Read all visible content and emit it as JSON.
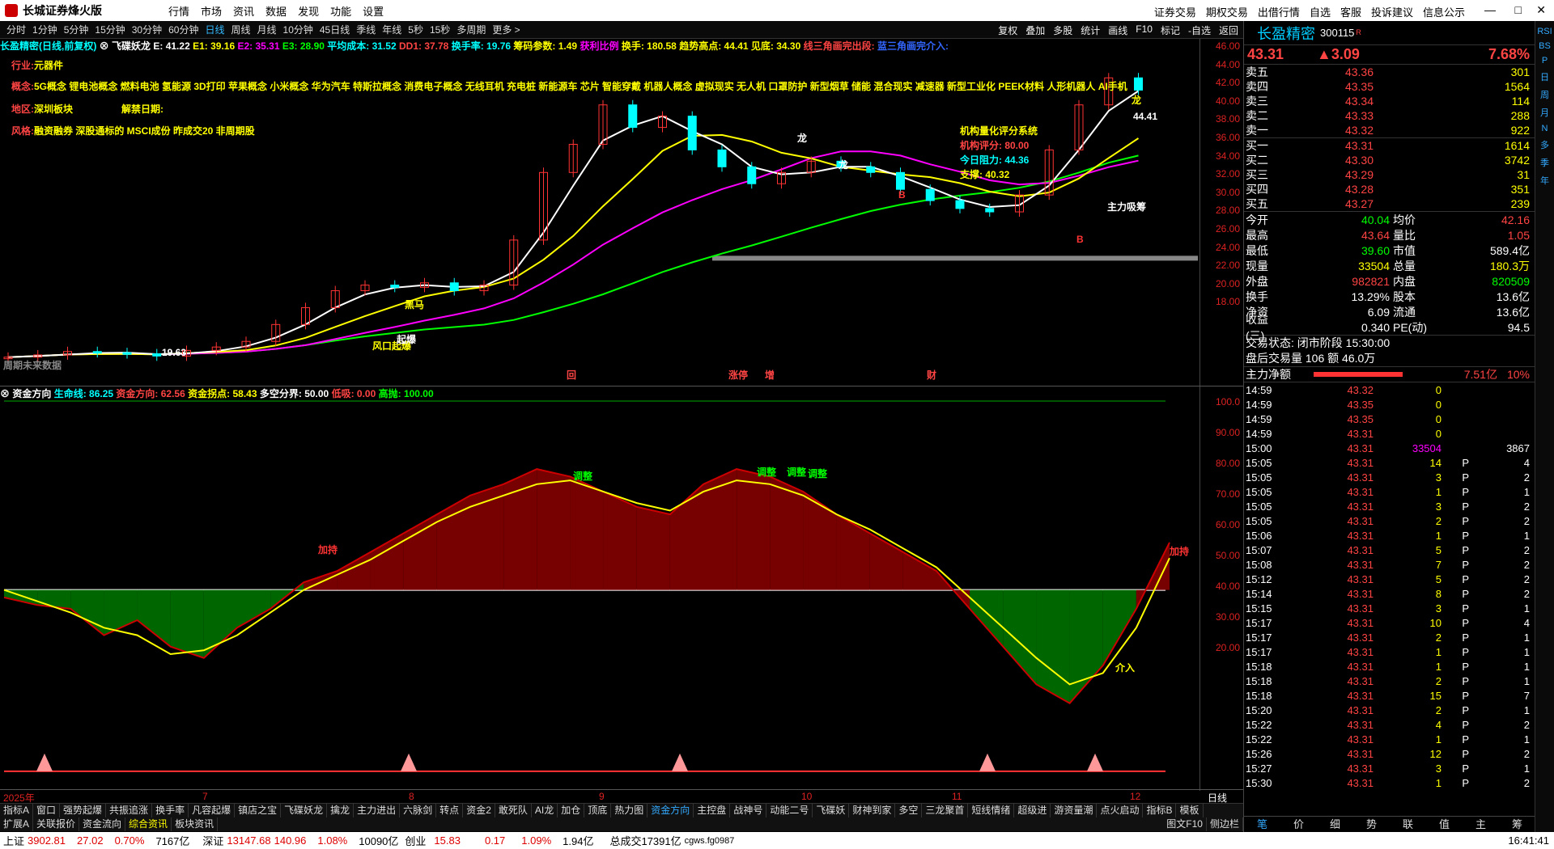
{
  "app": {
    "title": "长城证券烽火版"
  },
  "menu": [
    "行情",
    "市场",
    "资讯",
    "数据",
    "发现",
    "功能",
    "设置"
  ],
  "top_links": [
    "证券交易",
    "期权交易",
    "出借行情",
    "自选",
    "客服",
    "投诉建议",
    "信息公示"
  ],
  "periods": [
    "分时",
    "1分钟",
    "5分钟",
    "15分钟",
    "30分钟",
    "60分钟",
    "日线",
    "周线",
    "月线",
    "10分钟",
    "45日线",
    "季线",
    "年线",
    "5秒",
    "15秒",
    "多周期",
    "更多 >"
  ],
  "active_period": "日线",
  "tools_right": [
    "复权",
    "叠加",
    "多股",
    "统计",
    "画线",
    "F10",
    "标记",
    "-自选",
    "返回"
  ],
  "main_info": {
    "title": "长盈精密(日线,前复权)",
    "indicator": "飞碟妖龙",
    "e": "E: 41.22",
    "e1": "E1: 39.16",
    "e2": "E2: 35.31",
    "e3": "E3: 28.90",
    "avgcost": "平均成本: 31.52",
    "dd1": "DD1: 37.78",
    "turn": "换手率: 19.76",
    "chip": "筹码参数: 1.49",
    "profit": "获利比例",
    "hs": "换手: 180.58",
    "trend": "趋势高点: 44.41",
    "top": "见底: 34.30",
    "tri1": "线三角画完出段:",
    "tri2": "蓝三角画完介入:"
  },
  "tags": {
    "industry_label": "行业:",
    "industry": "元器件",
    "concept_label": "概念:",
    "concepts": "5G概念 锂电池概念 燃料电池 氢能源 3D打印 苹果概念 小米概念 华为汽车 特斯拉概念 消费电子概念 无线耳机 充电桩 新能源车 芯片 智能穿戴 机器人概念 虚拟现实 无人机 口罩防护 新型烟草 储能 混合现实 减速器 新型工业化 PEEK材料 人形机器人 AI手机",
    "region_label": "地区:",
    "region": "深圳板块",
    "unlock_label": "解禁日期:",
    "style_label": "风格:",
    "style": "融资融券 深股通标的 MSCI成份 昨成交20 非周期股"
  },
  "score_box": {
    "title": "机构量化评分系统",
    "score": "机构评分: 80.00",
    "resist": "今日阻力: 44.36",
    "support": "支撑: 40.32"
  },
  "chart_labels": [
    "龙",
    "龙",
    "龙",
    "黑马",
    "主力吸筹",
    "B",
    "B",
    "19.63",
    "44.41",
    "周期未来数据",
    "涨停",
    "增",
    "财",
    "回",
    "风口起爆",
    "起爆"
  ],
  "main_axis": [
    "46.00",
    "44.00",
    "42.00",
    "40.00",
    "38.00",
    "36.00",
    "34.00",
    "32.00",
    "30.00",
    "28.00",
    "26.00",
    "24.00",
    "22.00",
    "20.00",
    "18.00"
  ],
  "sub_axis": [
    "100.0",
    "90.00",
    "80.00",
    "70.00",
    "60.00",
    "50.00",
    "40.00",
    "30.00",
    "20.00"
  ],
  "sub_info": {
    "name": "资金方向",
    "life": "生命线: 86.25",
    "dir": "资金方向: 62.56",
    "inflect": "资金拐点: 58.43",
    "split": "多空分界: 50.00",
    "low": "低吸: 0.00",
    "high": "高抛: 100.00"
  },
  "sub_labels": [
    "调整",
    "调整",
    "调整",
    "调整",
    "加持",
    "加持",
    "介入"
  ],
  "dates": [
    "2025年",
    "7",
    "8",
    "9",
    "10",
    "11",
    "12"
  ],
  "date_right": "日线",
  "tabs1": [
    "指标A",
    "窗口",
    "强势起爆",
    "共振追涨",
    "换手率",
    "凡容起爆",
    "镇店之宝",
    "飞碟妖龙",
    "擒龙",
    "主力进出",
    "六脉剑",
    "转点",
    "资金2",
    "敢死队",
    "AI龙",
    "加仓",
    "顶底",
    "热力图",
    "资金方向",
    "主控盘",
    "战神号",
    "动能二号",
    "飞碟妖",
    "财神到家",
    "多空",
    "三龙聚首",
    "短线情绪",
    "超级进",
    "游资量潮",
    "点火启动",
    "指标B",
    "模板"
  ],
  "tabs1_active": "资金方向",
  "tabs2": [
    "扩展A",
    "关联报价",
    "资金流向",
    "综合资讯",
    "板块资讯"
  ],
  "tabs2_right": [
    "图文F10",
    "侧边栏"
  ],
  "quote": {
    "name": "长盈精密",
    "code": "300115",
    "badge": "R",
    "price": "43.31",
    "change": "▲3.09",
    "pct": "7.68%",
    "asks": [
      [
        "卖五",
        "43.36",
        "301"
      ],
      [
        "卖四",
        "43.35",
        "1564"
      ],
      [
        "卖三",
        "43.34",
        "114"
      ],
      [
        "卖二",
        "43.33",
        "288"
      ],
      [
        "卖一",
        "43.32",
        "922"
      ]
    ],
    "bids": [
      [
        "买一",
        "43.31",
        "1614"
      ],
      [
        "买二",
        "43.30",
        "3742"
      ],
      [
        "买三",
        "43.29",
        "31"
      ],
      [
        "买四",
        "43.28",
        "351"
      ],
      [
        "买五",
        "43.27",
        "239"
      ]
    ],
    "stats": [
      [
        "今开",
        "40.04",
        "均价",
        "42.16"
      ],
      [
        "最高",
        "43.64",
        "量比",
        "1.05"
      ],
      [
        "最低",
        "39.60",
        "市值",
        "589.4亿"
      ],
      [
        "现量",
        "33504",
        "总量",
        "180.3万"
      ],
      [
        "外盘",
        "982821",
        "内盘",
        "820509"
      ],
      [
        "换手",
        "13.29%",
        "股本",
        "13.6亿"
      ],
      [
        "净资",
        "6.09",
        "流通",
        "13.6亿"
      ],
      [
        "收益(三)",
        "0.340",
        "PE(动)",
        "94.5"
      ]
    ],
    "trade_state": "交易状态: 闭市阶段 15:30:00",
    "after": "盘后交易量 106 额 46.0万",
    "flow_label": "主力净额",
    "flow_val": "7.51亿",
    "flow_pct": "10%"
  },
  "ticks": [
    [
      "14:59",
      "43.32",
      "0",
      "",
      ""
    ],
    [
      "14:59",
      "43.35",
      "0",
      "",
      ""
    ],
    [
      "14:59",
      "43.35",
      "0",
      "",
      ""
    ],
    [
      "14:59",
      "43.31",
      "0",
      "",
      ""
    ],
    [
      "15:00",
      "43.31",
      "33504",
      "",
      "3867"
    ],
    [
      "15:05",
      "43.31",
      "14",
      "P",
      "4"
    ],
    [
      "15:05",
      "43.31",
      "3",
      "P",
      "2"
    ],
    [
      "15:05",
      "43.31",
      "1",
      "P",
      "1"
    ],
    [
      "15:05",
      "43.31",
      "3",
      "P",
      "2"
    ],
    [
      "15:05",
      "43.31",
      "2",
      "P",
      "2"
    ],
    [
      "15:06",
      "43.31",
      "1",
      "P",
      "1"
    ],
    [
      "15:07",
      "43.31",
      "5",
      "P",
      "2"
    ],
    [
      "15:08",
      "43.31",
      "7",
      "P",
      "2"
    ],
    [
      "15:12",
      "43.31",
      "5",
      "P",
      "2"
    ],
    [
      "15:14",
      "43.31",
      "8",
      "P",
      "2"
    ],
    [
      "15:15",
      "43.31",
      "3",
      "P",
      "1"
    ],
    [
      "15:17",
      "43.31",
      "10",
      "P",
      "4"
    ],
    [
      "15:17",
      "43.31",
      "2",
      "P",
      "1"
    ],
    [
      "15:17",
      "43.31",
      "1",
      "P",
      "1"
    ],
    [
      "15:18",
      "43.31",
      "1",
      "P",
      "1"
    ],
    [
      "15:18",
      "43.31",
      "2",
      "P",
      "1"
    ],
    [
      "15:18",
      "43.31",
      "15",
      "P",
      "7"
    ],
    [
      "15:20",
      "43.31",
      "2",
      "P",
      "1"
    ],
    [
      "15:22",
      "43.31",
      "4",
      "P",
      "2"
    ],
    [
      "15:22",
      "43.31",
      "1",
      "P",
      "1"
    ],
    [
      "15:26",
      "43.31",
      "12",
      "P",
      "2"
    ],
    [
      "15:27",
      "43.31",
      "3",
      "P",
      "1"
    ],
    [
      "15:30",
      "43.31",
      "1",
      "P",
      "2"
    ]
  ],
  "rp_bottom": [
    "笔",
    "价",
    "细",
    "势",
    "联",
    "值",
    "主",
    "筹"
  ],
  "sidebar": [
    "RSI",
    "BS",
    "P",
    "日",
    "周",
    "月",
    "N",
    "多",
    "季",
    "年"
  ],
  "status": {
    "sh_label": "上证",
    "sh": "3902.81",
    "sh_chg": "27.02",
    "sh_pct": "0.70%",
    "sh_amt": "7167亿",
    "sz_label": "深证",
    "sz": "13147.68",
    "sz_chg": "140.96",
    "sz_pct": "1.08%",
    "sz_amt": "10090亿",
    "cy_label": "创业",
    "cy": "15.83",
    "cy_chg": "0.17",
    "cy_pct": "1.09%",
    "cy_amt": "1.94亿",
    "total": "总成交17391亿",
    "server": "cgws.fg0987",
    "time": "16:41:41"
  },
  "colors": {
    "up": "#ff3333",
    "down": "#00ffff",
    "bg": "#000000",
    "accent": "#3399ff"
  },
  "chart_data": [
    {
      "type": "candlestick",
      "title": "长盈精密(日线,前复权)",
      "ylim": [
        18,
        46
      ],
      "x_months": [
        "2025年",
        "7",
        "8",
        "9",
        "10",
        "11",
        "12"
      ],
      "close_approx": [
        19.6,
        19.8,
        20.1,
        20.0,
        19.9,
        19.7,
        20.2,
        20.5,
        21.0,
        22.5,
        24.0,
        25.5,
        26.0,
        25.8,
        26.2,
        25.5,
        26.0,
        30.0,
        36.0,
        38.5,
        42.0,
        40.0,
        41.0,
        38.0,
        36.5,
        35.0,
        36.0,
        37.0,
        36.5,
        36.0,
        34.5,
        33.5,
        32.8,
        32.5,
        34.0,
        38.0,
        42.0,
        44.4,
        43.31
      ]
    },
    {
      "type": "line",
      "title": "资金方向",
      "ylim": [
        0,
        100
      ],
      "series": [
        {
          "name": "资金方向",
          "values": [
            48,
            46,
            45,
            38,
            42,
            35,
            32,
            40,
            45,
            52,
            55,
            60,
            65,
            70,
            75,
            78,
            82,
            80,
            76,
            72,
            70,
            78,
            82,
            80,
            76,
            70,
            65,
            60,
            55,
            45,
            35,
            25,
            20,
            30,
            45,
            62.56
          ]
        },
        {
          "name": "资金拐点",
          "values": [
            50,
            47,
            44,
            40,
            38,
            33,
            34,
            38,
            44,
            50,
            54,
            58,
            63,
            68,
            72,
            75,
            78,
            79,
            76,
            73,
            71,
            76,
            79,
            78,
            75,
            70,
            66,
            61,
            56,
            48,
            40,
            32,
            25,
            28,
            40,
            58.43
          ]
        }
      ]
    }
  ]
}
